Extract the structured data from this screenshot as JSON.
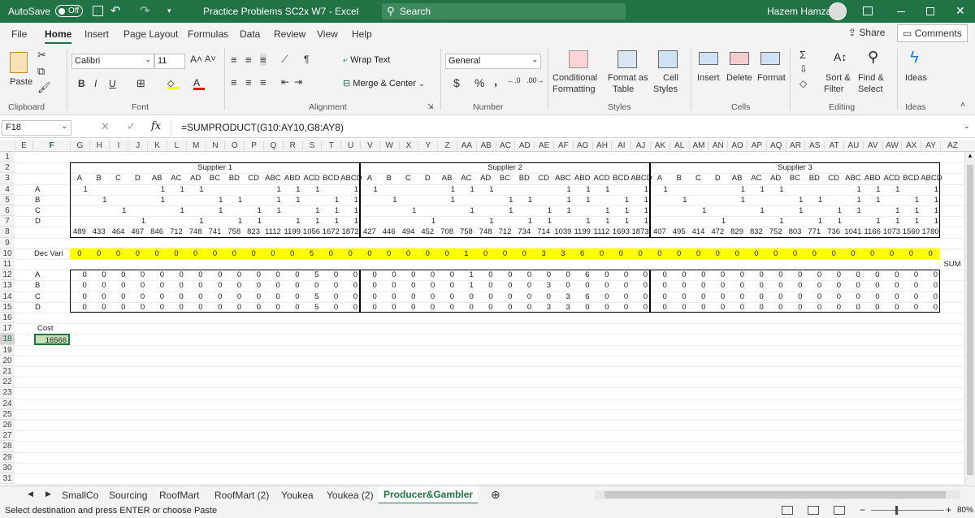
{
  "titlebar": {
    "autosave_label": "AutoSave",
    "autosave_state": "Off",
    "doc_title": "Practice Problems SC2x W7  -  Excel",
    "search_placeholder": "Search",
    "user": "Hazem Hamza"
  },
  "tabs": [
    "File",
    "Home",
    "Insert",
    "Page Layout",
    "Formulas",
    "Data",
    "Review",
    "View",
    "Help"
  ],
  "share_label": "Share",
  "comments_label": "Comments",
  "ribbon": {
    "paste": "Paste",
    "font_name": "Calibri",
    "font_size": "11",
    "bold": "B",
    "italic": "I",
    "underline": "U",
    "wrap_text": "Wrap Text",
    "merge_center": "Merge & Center",
    "number_format": "General",
    "currency": "$",
    "percent": "%",
    "comma": ",",
    "cond_fmt_1": "Conditional",
    "cond_fmt_2": "Formatting",
    "format_as_1": "Format as",
    "format_as_2": "Table",
    "cell_styles_1": "Cell",
    "cell_styles_2": "Styles",
    "insert": "Insert",
    "delete": "Delete",
    "format": "Format",
    "sort_1": "Sort &",
    "sort_2": "Filter",
    "find_1": "Find &",
    "find_2": "Select",
    "ideas": "Ideas",
    "groups": [
      "Clipboard",
      "Font",
      "Alignment",
      "Number",
      "Styles",
      "Cells",
      "Editing",
      "Ideas"
    ]
  },
  "name_box": "F18",
  "formula": "=SUMPRODUCT(G10:AY10,G8:AY8)",
  "columns": [
    "E",
    "F",
    "G",
    "H",
    "I",
    "J",
    "K",
    "L",
    "M",
    "N",
    "O",
    "P",
    "Q",
    "R",
    "S",
    "T",
    "U",
    "V",
    "W",
    "X",
    "Y",
    "Z",
    "AA",
    "AB",
    "AC",
    "AD",
    "AE",
    "AF",
    "AG",
    "AH",
    "AI",
    "AJ",
    "AK",
    "AL",
    "AM",
    "AN",
    "AO",
    "AP",
    "AQ",
    "AR",
    "AS",
    "AT",
    "AU",
    "AV",
    "AW",
    "AX",
    "AY",
    "AZ"
  ],
  "rows": [
    "1",
    "2",
    "3",
    "4",
    "5",
    "6",
    "7",
    "8",
    "9",
    "10",
    "11",
    "12",
    "13",
    "14",
    "15",
    "16",
    "17",
    "18",
    "19",
    "20",
    "21",
    "22",
    "23",
    "24",
    "25",
    "26",
    "27",
    "28",
    "29",
    "30",
    "31"
  ],
  "suppliers": [
    "Supplier 1",
    "Supplier 2",
    "Supplier 3"
  ],
  "bundles": [
    "A",
    "B",
    "C",
    "D",
    "AB",
    "AC",
    "AD",
    "BC",
    "BD",
    "CD",
    "ABC",
    "ABD",
    "ACD",
    "BCD",
    "ABCD"
  ],
  "item_labels": [
    "A",
    "B",
    "C",
    "D"
  ],
  "row8": [
    "489",
    "433",
    "464",
    "467",
    "846",
    "712",
    "748",
    "741",
    "758",
    "823",
    "1112",
    "1199",
    "1056",
    "1672",
    "1872",
    "427",
    "446",
    "494",
    "452",
    "708",
    "758",
    "748",
    "712",
    "734",
    "714",
    "1039",
    "1199",
    "1112",
    "1693",
    "1873",
    "407",
    "495",
    "414",
    "472",
    "829",
    "832",
    "752",
    "803",
    "771",
    "736",
    "1041",
    "1166",
    "1073",
    "1560",
    "1780"
  ],
  "row10_label": "Dec Vari",
  "row10": [
    "0",
    "0",
    "0",
    "0",
    "0",
    "0",
    "0",
    "0",
    "0",
    "0",
    "0",
    "0",
    "5",
    "0",
    "0",
    "0",
    "0",
    "0",
    "0",
    "0",
    "1",
    "0",
    "0",
    "0",
    "3",
    "3",
    "6",
    "0",
    "0",
    "0",
    "0",
    "0",
    "0",
    "0",
    "0",
    "0",
    "0",
    "0",
    "0",
    "0",
    "0",
    "0",
    "0",
    "0",
    "0"
  ],
  "row11_label": "SUM",
  "row12": [
    "0",
    "0",
    "0",
    "0",
    "0",
    "0",
    "0",
    "0",
    "0",
    "0",
    "0",
    "0",
    "5",
    "0",
    "0",
    "0",
    "0",
    "0",
    "0",
    "0",
    "1",
    "0",
    "0",
    "0",
    "0",
    "0",
    "6",
    "0",
    "0",
    "0",
    "0",
    "0",
    "0",
    "0",
    "0",
    "0",
    "0",
    "0",
    "0",
    "0",
    "0",
    "0",
    "0",
    "0",
    "0"
  ],
  "row13": [
    "0",
    "0",
    "0",
    "0",
    "0",
    "0",
    "0",
    "0",
    "0",
    "0",
    "0",
    "0",
    "0",
    "0",
    "0",
    "0",
    "0",
    "0",
    "0",
    "0",
    "1",
    "0",
    "0",
    "0",
    "3",
    "0",
    "0",
    "0",
    "0",
    "0",
    "0",
    "0",
    "0",
    "0",
    "0",
    "0",
    "0",
    "0",
    "0",
    "0",
    "0",
    "0",
    "0",
    "0",
    "0"
  ],
  "row14": [
    "0",
    "0",
    "0",
    "0",
    "0",
    "0",
    "0",
    "0",
    "0",
    "0",
    "0",
    "0",
    "5",
    "0",
    "0",
    "0",
    "0",
    "0",
    "0",
    "0",
    "0",
    "0",
    "0",
    "0",
    "0",
    "3",
    "6",
    "0",
    "0",
    "0",
    "0",
    "0",
    "0",
    "0",
    "0",
    "0",
    "0",
    "0",
    "0",
    "0",
    "0",
    "0",
    "0",
    "0",
    "0"
  ],
  "row15": [
    "0",
    "0",
    "0",
    "0",
    "0",
    "0",
    "0",
    "0",
    "0",
    "0",
    "0",
    "0",
    "5",
    "0",
    "0",
    "0",
    "0",
    "0",
    "0",
    "0",
    "0",
    "0",
    "0",
    "0",
    "3",
    "3",
    "0",
    "0",
    "0",
    "0",
    "0",
    "0",
    "0",
    "0",
    "0",
    "0",
    "0",
    "0",
    "0",
    "0",
    "0",
    "0",
    "0",
    "0",
    "0"
  ],
  "cost_label": "Cost",
  "cost_value": "16566",
  "sheets": [
    "SmallCo",
    "Sourcing",
    "RoofMart",
    "RoofMart (2)",
    "Youkea",
    "Youkea (2)",
    "Producer&Gambler"
  ],
  "status_text": "Select destination and press ENTER or choose Paste",
  "zoom": "80%",
  "colors": {
    "excel_green": "#217346",
    "highlight": "#ffff00",
    "selected_cell": "#c6e0b4"
  }
}
